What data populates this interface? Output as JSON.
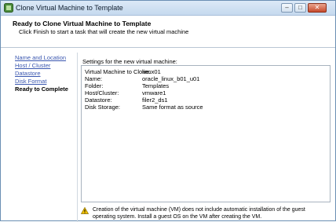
{
  "window": {
    "title": "Clone Virtual Machine to Template"
  },
  "header": {
    "heading": "Ready to Clone Virtual Machine to Template",
    "subtitle": "Click Finish to start a task that will create the new virtual machine"
  },
  "nav": {
    "items": [
      {
        "label": "Name and Location"
      },
      {
        "label": "Host / Cluster"
      },
      {
        "label": "Datastore"
      },
      {
        "label": "Disk Format"
      },
      {
        "label": "Ready to Complete"
      }
    ]
  },
  "settings": {
    "label": "Settings for the new virtual machine:",
    "rows": [
      {
        "key": "Virtual Machine to Clone:",
        "value": "linux01"
      },
      {
        "key": "Name:",
        "value": "oracle_linux_b01_u01"
      },
      {
        "key": "Folder:",
        "value": "Templates"
      },
      {
        "key": "Host/Cluster:",
        "value": "vmware1"
      },
      {
        "key": "Datastore:",
        "value": "filer2_ds1"
      },
      {
        "key": "Disk Storage:",
        "value": "Same format as source"
      }
    ]
  },
  "warning": {
    "text": "Creation of the virtual machine (VM) does not include automatic installation of the guest operating system. Install a guest OS on the VM after creating the VM."
  },
  "colors": {
    "link": "#3a57b0",
    "warning": "#f2c200"
  }
}
